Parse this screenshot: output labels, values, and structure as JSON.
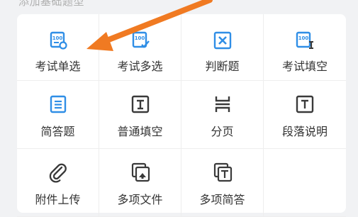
{
  "section_title": "添加基础题型",
  "colors": {
    "blue": "#2f8ee6",
    "dark": "#3a3a3a",
    "arrow": "#f07a22"
  },
  "tiles": [
    {
      "label": "考试单选",
      "icon": "exam-single-choice-icon"
    },
    {
      "label": "考试多选",
      "icon": "exam-multi-choice-icon"
    },
    {
      "label": "判断题",
      "icon": "true-false-icon"
    },
    {
      "label": "考试填空",
      "icon": "exam-fill-blank-icon"
    },
    {
      "label": "简答题",
      "icon": "short-answer-icon"
    },
    {
      "label": "普通填空",
      "icon": "fill-blank-icon"
    },
    {
      "label": "分页",
      "icon": "page-break-icon"
    },
    {
      "label": "段落说明",
      "icon": "paragraph-note-icon"
    },
    {
      "label": "附件上传",
      "icon": "attachment-upload-icon"
    },
    {
      "label": "多项文件",
      "icon": "multi-file-icon"
    },
    {
      "label": "多项简答",
      "icon": "multi-short-answer-icon"
    }
  ]
}
